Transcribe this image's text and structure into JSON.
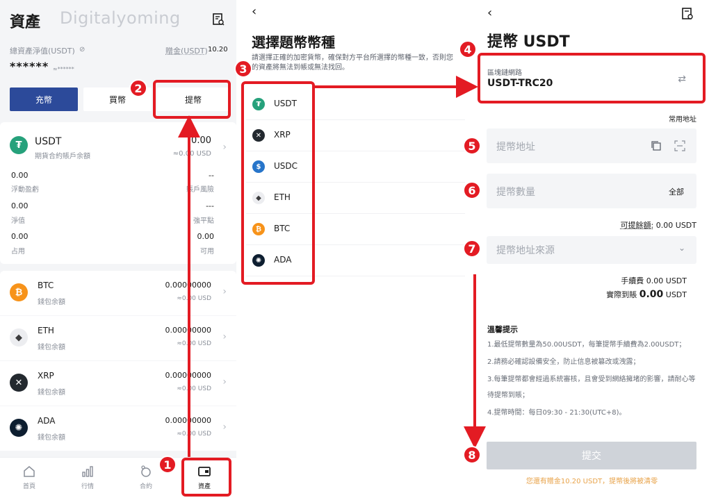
{
  "assets": {
    "title": "資產",
    "watermark": "Digitalyoming",
    "total_label": "總資產淨值(USDT)",
    "bonus_label": "贈金(USDT)",
    "bonus_value": "10.20",
    "hidden_balance": "******",
    "hidden_sub": "≈******",
    "buttons": {
      "deposit": "充幣",
      "buy": "買幣",
      "withdraw": "提幣"
    },
    "usdt_card": {
      "name": "USDT",
      "sub": "期貨合約賬戶余額",
      "value": "0.00",
      "approx": "≈0.00 USD",
      "stats": [
        {
          "value": "0.00",
          "label": "浮動盈虧",
          "side": "left"
        },
        {
          "value": "--",
          "label": "賬戶風險",
          "side": "right"
        },
        {
          "value": "0.00",
          "label": "淨值",
          "side": "left"
        },
        {
          "value": "---",
          "label": "強平點",
          "side": "right"
        },
        {
          "value": "0.00",
          "label": "占用",
          "side": "left"
        },
        {
          "value": "0.00",
          "label": "可用",
          "side": "right"
        }
      ]
    },
    "coins": [
      {
        "name": "BTC",
        "sub": "錢包余額",
        "value": "0.00000000",
        "approx": "≈0.00 USD",
        "color": "#f7931a",
        "glyph": "₿"
      },
      {
        "name": "ETH",
        "sub": "錢包余額",
        "value": "0.00000000",
        "approx": "≈0.00 USD",
        "color": "#ecedf0",
        "glyph": "◆"
      },
      {
        "name": "XRP",
        "sub": "錢包余額",
        "value": "0.00000000",
        "approx": "≈0.00 USD",
        "color": "#23292f",
        "glyph": "✕"
      },
      {
        "name": "ADA",
        "sub": "錢包余額",
        "value": "0.00000000",
        "approx": "≈0.00 USD",
        "color": "#0d1e30",
        "glyph": "✺"
      }
    ],
    "tabs": [
      {
        "label": "首頁",
        "icon": "home-icon"
      },
      {
        "label": "行情",
        "icon": "chart-icon"
      },
      {
        "label": "合約",
        "icon": "contract-icon"
      },
      {
        "label": "資產",
        "icon": "wallet-icon"
      }
    ]
  },
  "select_coin": {
    "title": "選擇題幣幣種",
    "description": "請選擇正確的加密貨幣，確保對方平台所選擇的幣種一致，否則您的資產將無法到帳或無法找回。",
    "coins": [
      {
        "name": "USDT",
        "color": "#26a17b",
        "glyph": "₮"
      },
      {
        "name": "XRP",
        "color": "#23292f",
        "glyph": "✕"
      },
      {
        "name": "USDC",
        "color": "#2775ca",
        "glyph": "$"
      },
      {
        "name": "ETH",
        "color": "#ecedf0",
        "glyph": "◆"
      },
      {
        "name": "BTC",
        "color": "#f7931a",
        "glyph": "₿"
      },
      {
        "name": "ADA",
        "color": "#0d1e30",
        "glyph": "✺"
      }
    ]
  },
  "withdraw": {
    "title": "提幣 USDT",
    "network_label": "區塊鏈網路",
    "network_value": "USDT-TRC20",
    "common_address": "常用地址",
    "address_placeholder": "提幣地址",
    "amount_placeholder": "提幣數量",
    "amount_all": "全部",
    "available_label": "可提餘額:",
    "available_value": "0.00 USDT",
    "source_placeholder": "提幣地址來源",
    "fee_label": "手續費",
    "fee_value": "0.00 USDT",
    "actual_label": "實際到賬",
    "actual_value": "0.00",
    "actual_unit": "USDT",
    "tips_title": "溫馨提示",
    "tips": [
      "1.最低提幣數量為50.00USDT，每筆提幣手續費為2.00USDT；",
      "2.請務必確認設備安全，防止信息被篡改或洩露；",
      "3.每筆提幣都會經過系統審核，且會受到網絡擁堵的影響，請耐心等待提幣到賬；",
      "4.提幣時間：每日09:30 - 21:30(UTC+8)。"
    ],
    "submit": "提交",
    "bonus_note": "您還有贈金10.20 USDT，提幣後將被清零"
  },
  "markers": [
    "1",
    "2",
    "3",
    "4",
    "5",
    "6",
    "7",
    "8"
  ],
  "colors": {
    "accent": "#2c4a9a",
    "marker": "#e31b23",
    "note": "#e8a34a"
  }
}
